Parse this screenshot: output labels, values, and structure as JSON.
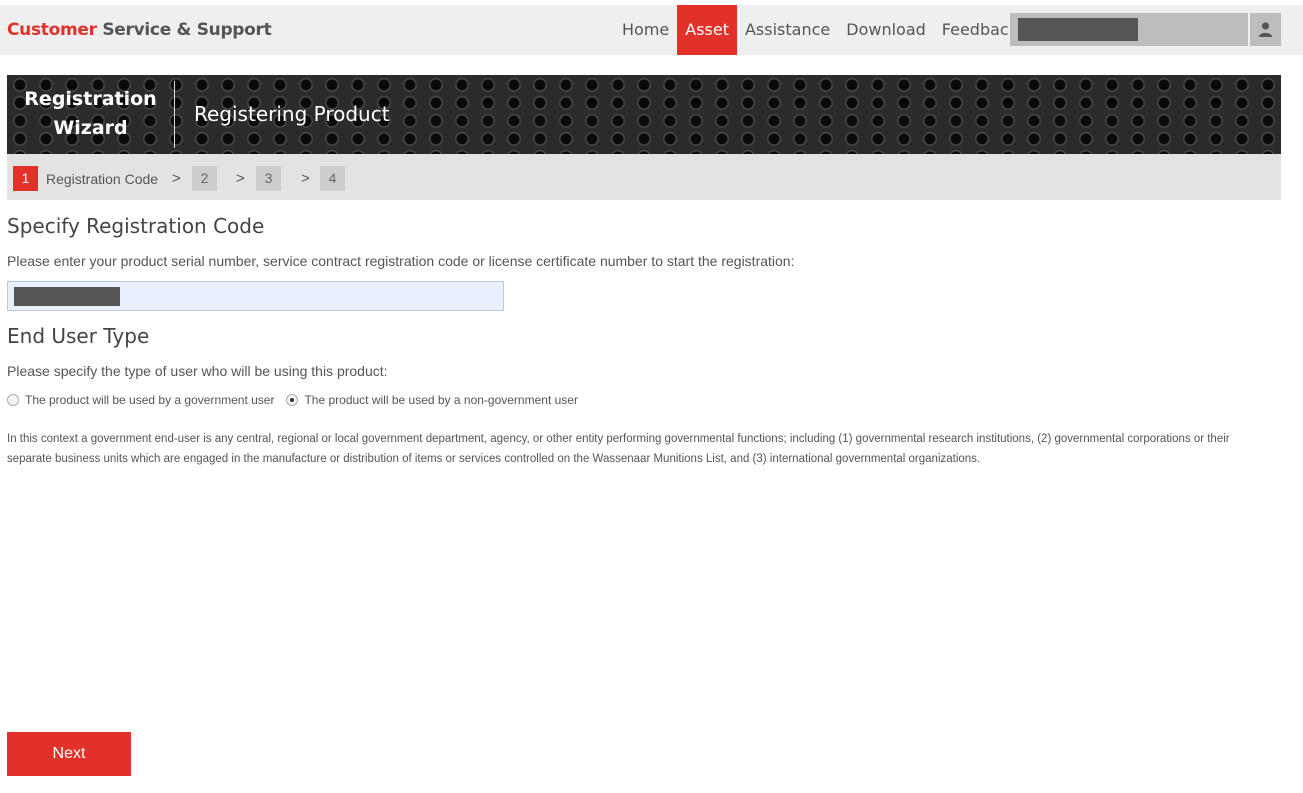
{
  "header": {
    "brand_accent": "Customer",
    "brand_rest": "Service & Support",
    "nav": [
      {
        "label": "Home",
        "active": false
      },
      {
        "label": "Asset",
        "active": true
      },
      {
        "label": "Assistance",
        "active": false
      },
      {
        "label": "Download",
        "active": false
      },
      {
        "label": "Feedback",
        "active": false
      }
    ],
    "account_icon": "user-icon"
  },
  "banner": {
    "title_line1": "Registration",
    "title_line2": "Wizard",
    "subtitle": "Registering Product"
  },
  "steps": {
    "items": [
      "1",
      "2",
      "3",
      "4"
    ],
    "active_label": "Registration Code",
    "separator": ">"
  },
  "registration": {
    "heading": "Specify Registration Code",
    "instruction": "Please enter your product serial number, service contract registration code or license certificate number to start the registration:"
  },
  "user_type": {
    "heading": "End User Type",
    "instruction": "Please specify the type of user who will be using this product:",
    "options": [
      {
        "label": "The product will be used by a government user",
        "checked": false
      },
      {
        "label": "The product will be used by a non-government user",
        "checked": true
      }
    ],
    "note": "In this context a government end-user is any central, regional or local government department, agency, or other entity performing governmental functions; including (1) governmental research institutions, (2) governmental corporations or their separate business units which are engaged in the manufacture or distribution of items or services controlled on the Wassenaar Munitions List, and (3) international governmental organizations."
  },
  "actions": {
    "next_label": "Next"
  },
  "colors": {
    "accent": "#e2312a",
    "topbar": "#efefef",
    "step_bar": "#e3e3e3"
  }
}
